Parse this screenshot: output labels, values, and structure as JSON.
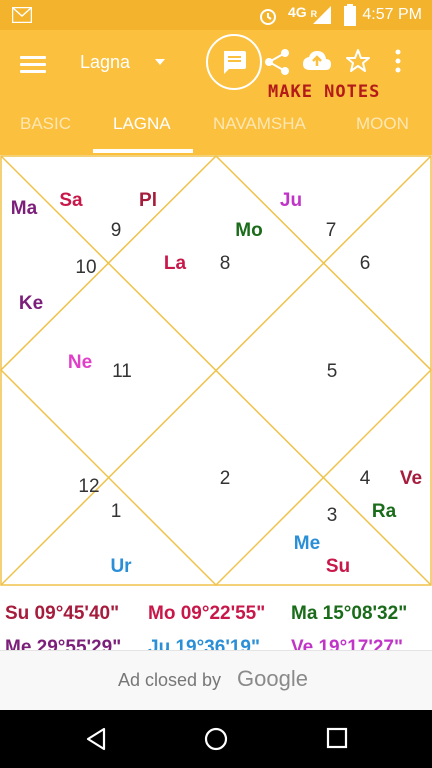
{
  "status_bar": {
    "network": "4G",
    "roaming": "R",
    "time": "4:57 PM",
    "icons": [
      "gmail-icon",
      "alarm-icon",
      "signal-icon",
      "battery-icon"
    ]
  },
  "toolbar": {
    "chart_select": "Lagna",
    "make_notes": "MAKE NOTES",
    "icons": [
      "menu-icon",
      "notes-icon",
      "share-icon",
      "cloud-upload-icon",
      "star-icon",
      "more-icon"
    ]
  },
  "tabs": [
    {
      "label": "BASIC",
      "active": false
    },
    {
      "label": "LAGNA",
      "active": true
    },
    {
      "label": "NAVAMSHA",
      "active": false
    },
    {
      "label": "MOON",
      "active": false
    }
  ],
  "chart": {
    "houses": [
      "1",
      "2",
      "3",
      "4",
      "5",
      "6",
      "7",
      "8",
      "9",
      "10",
      "11",
      "12"
    ],
    "planets": [
      {
        "abbr": "Ma",
        "color": "#7b1f7a"
      },
      {
        "abbr": "Sa",
        "color": "#c8184a"
      },
      {
        "abbr": "Pl",
        "color": "#a61c3c"
      },
      {
        "abbr": "Ju",
        "color": "#c035c8"
      },
      {
        "abbr": "Mo",
        "color": "#1a6b1a"
      },
      {
        "abbr": "La",
        "color": "#c8184a"
      },
      {
        "abbr": "Ke",
        "color": "#7b1f7a"
      },
      {
        "abbr": "Ne",
        "color": "#e040c8"
      },
      {
        "abbr": "Ve",
        "color": "#a61c3c"
      },
      {
        "abbr": "Ra",
        "color": "#1a6b1a"
      },
      {
        "abbr": "Me",
        "color": "#2a8fd6"
      },
      {
        "abbr": "Su",
        "color": "#c8184a"
      },
      {
        "abbr": "Ur",
        "color": "#2a8fd6"
      }
    ],
    "line_color": "#f0c24a"
  },
  "degrees": [
    {
      "label": "Su 09°45'40\"",
      "color": "#a61c3c"
    },
    {
      "label": "Mo 09°22'55\"",
      "color": "#c8184a"
    },
    {
      "label": "Ma 15°08'32\"",
      "color": "#1a6b1a"
    },
    {
      "label": "Me 29°55'29\"",
      "color": "#7b1f7a"
    },
    {
      "label": "Ju 19°36'19\"",
      "color": "#2a8fd6"
    },
    {
      "label": "Ve 19°17'27\"",
      "color": "#c035c8"
    }
  ],
  "ad": {
    "text": "Ad closed by",
    "brand": "Google"
  },
  "nav": [
    "back-icon",
    "home-icon",
    "recents-icon"
  ],
  "colors": {
    "accent": "#fbc03d",
    "status_bar": "#f3b32c"
  }
}
